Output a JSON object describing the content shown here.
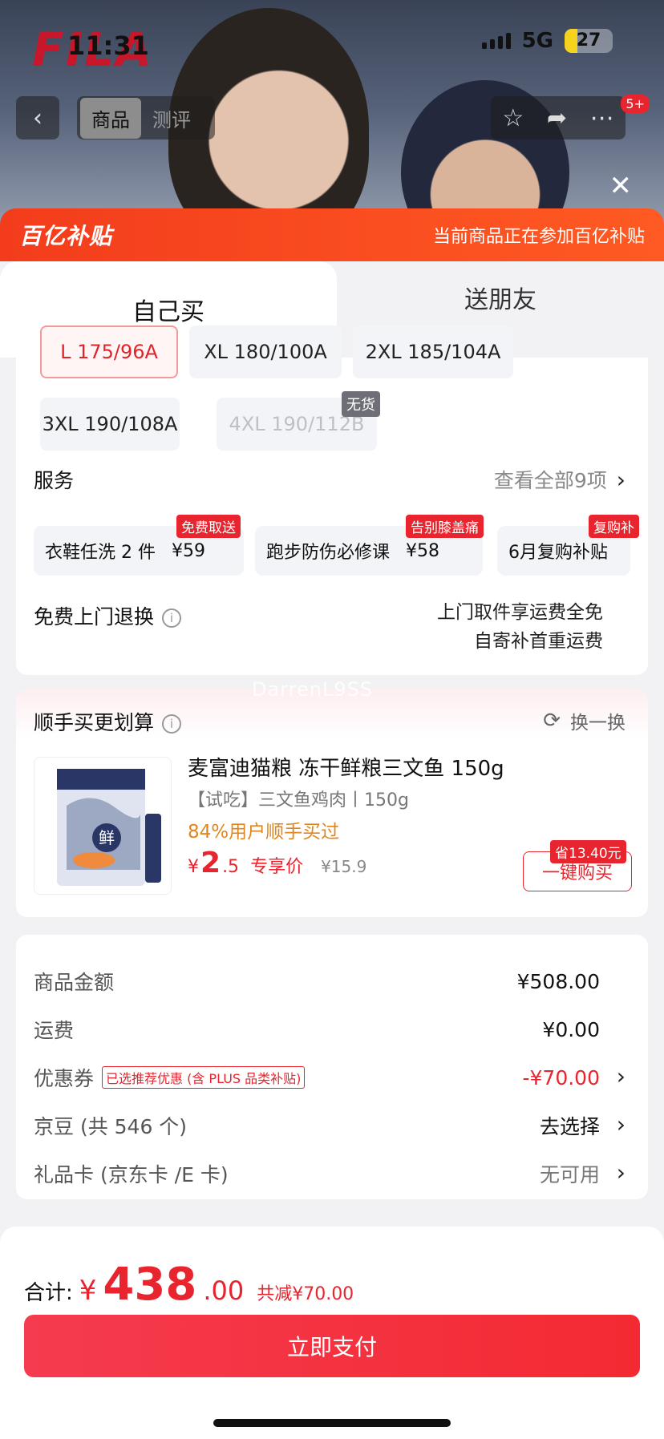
{
  "status": {
    "time": "11:31",
    "network": "5G",
    "battery": "27",
    "battery_level": 0.27
  },
  "brand": {
    "logo_text": "FILA"
  },
  "nav": {
    "tabs": [
      "商品",
      "测评"
    ],
    "more_badge": "5+"
  },
  "subsidy": {
    "logo": "百亿补贴",
    "tip": "当前商品正在参加百亿补贴"
  },
  "buy_tabs": {
    "self": "自己买",
    "friend": "送朋友"
  },
  "sizes": {
    "row1": [
      "L 175/96A",
      "XL 180/100A",
      "2XL 185/104A"
    ],
    "row2": [
      "3XL 190/108A",
      "4XL 190/112B"
    ],
    "out_of_stock": "无货"
  },
  "service": {
    "title": "服务",
    "see_all": "查看全部9项",
    "items": [
      {
        "name": "衣鞋任洗 2 件",
        "price": "¥59",
        "tag": "免费取送"
      },
      {
        "name": "跑步防伤必修课",
        "price": "¥58",
        "tag": "告别膝盖痛"
      },
      {
        "name": "6月复购补贴",
        "price": "",
        "tag": "复购补"
      }
    ]
  },
  "return": {
    "title": "免费上门退换",
    "line1": "上门取件享运费全免",
    "line2": "自寄补首重运费"
  },
  "watermark": "DarrenL9SS",
  "addon": {
    "title": "顺手买更划算",
    "swap": "换一换",
    "product": {
      "name": "麦富迪猫粮 冻干鲜粮三文鱼 150g",
      "spec": "【试吃】三文鱼鸡肉丨150g",
      "bought": "84%用户顺手买过",
      "price_symbol": "¥",
      "price_int": "2",
      "price_dec": ".5",
      "price_label": "专享价",
      "orig_price": "¥15.9",
      "save_tag": "省13.40元",
      "buy_btn": "一键购买"
    }
  },
  "fees": {
    "goods_label": "商品金额",
    "goods_value": "¥508.00",
    "shipping_label": "运费",
    "shipping_value": "¥0.00",
    "coupon_label": "优惠券",
    "coupon_tag": "已选推荐优惠 (含 PLUS 品类补贴)",
    "coupon_value": "-¥70.00",
    "beans_label": "京豆 (共 546 个)",
    "beans_value": "去选择",
    "giftcard_label": "礼品卡 (京东卡 /E 卡)",
    "giftcard_value": "无可用"
  },
  "footer": {
    "total_label": "合计:",
    "currency": "¥",
    "total_int": "438",
    "total_dec": ".00",
    "saved": "共减¥70.00",
    "pay_btn": "立即支付"
  },
  "colors": {
    "accent": "#e8242e",
    "subsidy": "#f33c1c"
  }
}
